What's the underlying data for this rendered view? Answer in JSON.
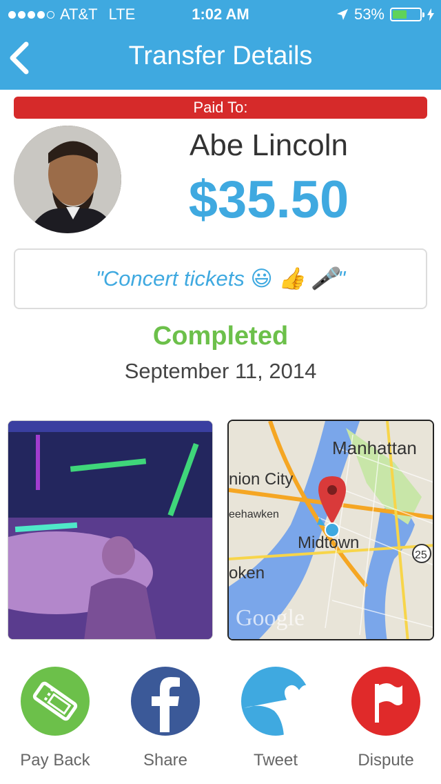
{
  "status_bar": {
    "carrier": "AT&T",
    "network": "LTE",
    "time": "1:02 AM",
    "battery": "53%",
    "battery_level": 0.53
  },
  "nav": {
    "title": "Transfer Details"
  },
  "transfer": {
    "paid_label": "Paid To:",
    "payee": "Abe Lincoln",
    "amount": "$35.50",
    "memo": "\"Concert tickets 😃 👍 🎤\"",
    "status": "Completed",
    "date": "September 11, 2014"
  },
  "map": {
    "labels": {
      "manhattan": "Manhattan",
      "union_city": "nion City",
      "weehawken": "eehawken",
      "midtown": "Midtown",
      "hoboken": "oken",
      "route": "25",
      "google": "Google"
    }
  },
  "actions": [
    {
      "label": "Pay Back",
      "color": "#6cc04a",
      "icon": "ticket-icon"
    },
    {
      "label": "Share",
      "color": "#3b5998",
      "icon": "facebook-icon"
    },
    {
      "label": "Tweet",
      "color": "#3fa9e0",
      "icon": "twitter-bird-icon"
    },
    {
      "label": "Dispute",
      "color": "#e02a2a",
      "icon": "flag-icon"
    }
  ],
  "colors": {
    "header": "#3fa9e0",
    "banner": "#d62a2a",
    "amount": "#3fa9e0",
    "completed": "#6cc04a"
  }
}
